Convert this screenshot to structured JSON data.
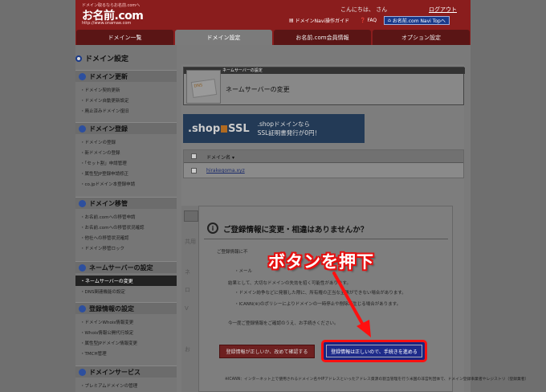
{
  "header": {
    "tagline": "ドメイン取るならお名前.comへ",
    "logo": "お名前.com",
    "logo_url": "http://www.onamae.com",
    "greeting": "こんにちは、                    さん",
    "logout": "ログアウト",
    "links": [
      "ドメインNavi操作ガイド",
      "FAQ",
      "お名前.com Navi Topへ"
    ]
  },
  "tabs": [
    "ドメイン一覧",
    "ドメイン設定",
    "お名前.com会員情報",
    "オプション設定"
  ],
  "active_tab": "ドメイン設定",
  "sidebar": {
    "title": "ドメイン設定",
    "sections": [
      {
        "title": "ドメイン更新",
        "items": [
          "ドメイン契約更新",
          "ドメイン自動更新設定",
          "廃止済みドメイン復旧"
        ]
      },
      {
        "title": "ドメイン登録",
        "items": [
          "ドメインの登録",
          "新ドメインの登録",
          "「セット割」申請管理",
          "属性型JP登録申請修正",
          "co.jpドメイン本登録申請"
        ]
      },
      {
        "title": "ドメイン移管",
        "items": [
          "お名前.comへの移管申請",
          "お名前.comへの移管状況確認",
          "他社への移管状況確認",
          "ドメイン移管ロック"
        ]
      },
      {
        "title": "ネームサーバーの設定",
        "items": [
          "ネームサーバーの変更",
          "DNS関連機能の設定"
        ]
      },
      {
        "title": "登録情報の設定",
        "items": [
          "ドメインWhois情報変更",
          "Whois情報公開代行設定",
          "属性型JPドメイン情報変更",
          "TMCH管理"
        ]
      },
      {
        "title": "ドメインサービス",
        "items": [
          "プレミアムドメインの管理"
        ]
      }
    ],
    "active_item": "ネームサーバーの変更"
  },
  "panel": {
    "header": "ネームサーバーの設定",
    "title": "ネームサーバーの変更",
    "img_text": "DNS"
  },
  "banner": {
    "logo": ".shop",
    "ssl": "SSL",
    "line1": ".shopドメインなら",
    "line2": "SSL証明書発行が0円！"
  },
  "table": {
    "header": "ドメイン名",
    "rows": [
      "hirakegoma.xyz"
    ]
  },
  "modal": {
    "title": "ご登録情報に変更・相違はありませんか？",
    "lines": [
      "ご登録情報に不",
      "・メール",
      "結果として、大切なドメインの失効を招く可能性があります。",
      "・ドメイン紛争などに発展した際に、所有権の正当な主張ができない場合があります。",
      "・ICANN(※)のポリシーによりドメインの一時停止や削除が生じる場合があります。",
      "今一度ご登録情報をご確認のうえ、お手続きください。"
    ],
    "btn_fix": "登録情報が正しいか、改めて確認する",
    "btn_proceed": "登録情報は正しいので、手続きを進める",
    "footnote": "※ICANN：インターネット上で使用されるドメイン名やIPアドレスといったアドレス資源の割当管理を行う米国の非営利団体で、ドメイン登録事業者やレジストリ（登録業者）"
  },
  "annotation": "ボタンを押下",
  "bg_fragments": [
    "共用",
    "ネ",
    "ロ",
    "V",
    "お"
  ],
  "colors": {
    "header": "#8a1d1d",
    "proceed_button": "#1e2b8a",
    "highlight": "#ff1010"
  }
}
